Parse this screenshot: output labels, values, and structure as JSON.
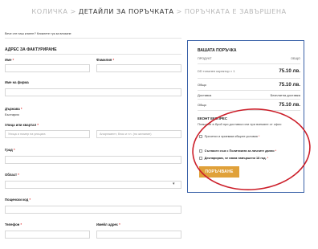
{
  "breadcrumb": {
    "cart": "КОЛИЧКА",
    "details": "ДЕТАЙЛИ ЗА ПОРЪЧКАТА",
    "done": "ПОРЪЧКАТА Е ЗАВЪРШЕНА",
    "separator": ">"
  },
  "returning_customer": "Вече сте наш клиент? Кликнете тук за влизане",
  "billing": {
    "title": "АДРЕС ЗА ФАКТУРИРАНЕ",
    "first_name": "Име",
    "last_name": "Фамилия",
    "company": "Име на фирма",
    "country_label": "Държава",
    "country_value": "България",
    "street_label": "Улица или квартал",
    "street_placeholder": "Улица и номер на улицата",
    "apartment_placeholder": "Апартамент, блок и т.н. (по желание)",
    "city": "Град",
    "region": "Област",
    "postcode": "Пощенски код",
    "phone": "Телефон",
    "email": "Имейл адрес",
    "required_mark": "*",
    "select_arrow": "▾"
  },
  "order": {
    "title": "ВАШАТА ПОРЪЧКА",
    "col_product": "ПРОДУКТ",
    "col_total": "ОБЩО",
    "item_name": "DD тонален коректор × 1",
    "item_price": "75.10 лв.",
    "subtotal_label": "Общо",
    "subtotal_value": "75.10 лв.",
    "shipping_label": "Доставка",
    "shipping_value": "Безплатна доставка",
    "total_label": "Общо",
    "total_value": "75.10 лв.",
    "payment_title": "ЕКОНТ ЕКСПРЕС",
    "payment_desc": "Плащане в брой при доставка или при вземане от офис",
    "terms": "Прочетох и приемам общите условия",
    "privacy": "Съгласен съм с Политиката за личните данни",
    "age": "Декларирам, че имам навършени 18 год.",
    "required_mark": "*",
    "button": "ПОРЪЧВАНЕ",
    "accent_color": "#e0a13a",
    "border_color": "#3a62a8",
    "annotation_color": "#cc1f2a"
  }
}
